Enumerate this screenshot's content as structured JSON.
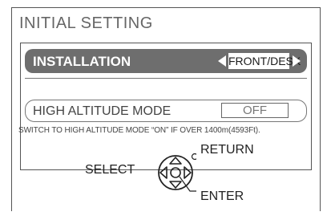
{
  "menu": {
    "title": "INITIAL SETTING",
    "installation": {
      "label": "INSTALLATION",
      "value": "FRONT/DESK"
    },
    "high_altitude": {
      "label": "HIGH ALTITUDE MODE",
      "value": "OFF"
    },
    "note": "SWITCH TO HIGH ALTITUDE MODE “ON” IF OVER 1400m(4593Ft)."
  },
  "guide": {
    "select_label": "SELECT",
    "return_label": "RETURN",
    "enter_label": "ENTER"
  },
  "icons": {
    "left": "triangle-left-icon",
    "right": "triangle-right-icon",
    "dpad": "dpad-icon",
    "return": "return-circle-icon"
  },
  "colors": {
    "highlight_bar": "#6e6e6e",
    "title_text": "#666666",
    "frame": "#555555"
  }
}
